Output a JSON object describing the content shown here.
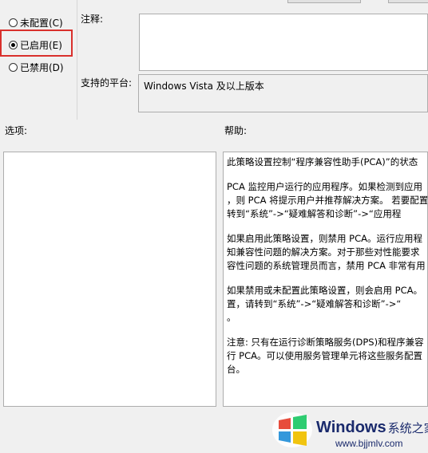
{
  "radios": [
    {
      "label": "未配置(C)",
      "checked": false
    },
    {
      "label": "已启用(E)",
      "checked": true
    },
    {
      "label": "已禁用(D)",
      "checked": false
    }
  ],
  "comment": {
    "label": "注释:",
    "value": ""
  },
  "platform": {
    "label": "支持的平台:",
    "value": "Windows Vista 及以上版本"
  },
  "options": {
    "label": "选项:"
  },
  "help": {
    "label": "帮助:",
    "paragraphs": [
      [
        "此策略设置控制“程序兼容性助手(PCA)”的状态"
      ],
      [
        "PCA 监控用户运行的应用程序。如果检测到应用",
        "，则 PCA 将提示用户并推荐解决方案。 若要配置",
        "转到“系统”->“疑难解答和诊断”->“应用程"
      ],
      [
        "如果启用此策略设置，则禁用 PCA。运行应用程",
        "知兼容性问题的解决方案。对于那些对性能要求",
        "容性问题的系统管理员而言，禁用 PCA 非常有用"
      ],
      [
        "如果禁用或未配置此策略设置，则会启用 PCA。",
        "置，请转到“系统”->“疑难解答和诊断”->“",
        "。"
      ],
      [
        "注意: 只有在运行诊断策略服务(DPS)和程序兼容",
        "行 PCA。可以使用服务管理单元将这些服务配置",
        "台。"
      ]
    ]
  },
  "watermark": {
    "brand": "Windows",
    "brand_cn": "系统之家",
    "url": "www.bjjmlv.com"
  }
}
